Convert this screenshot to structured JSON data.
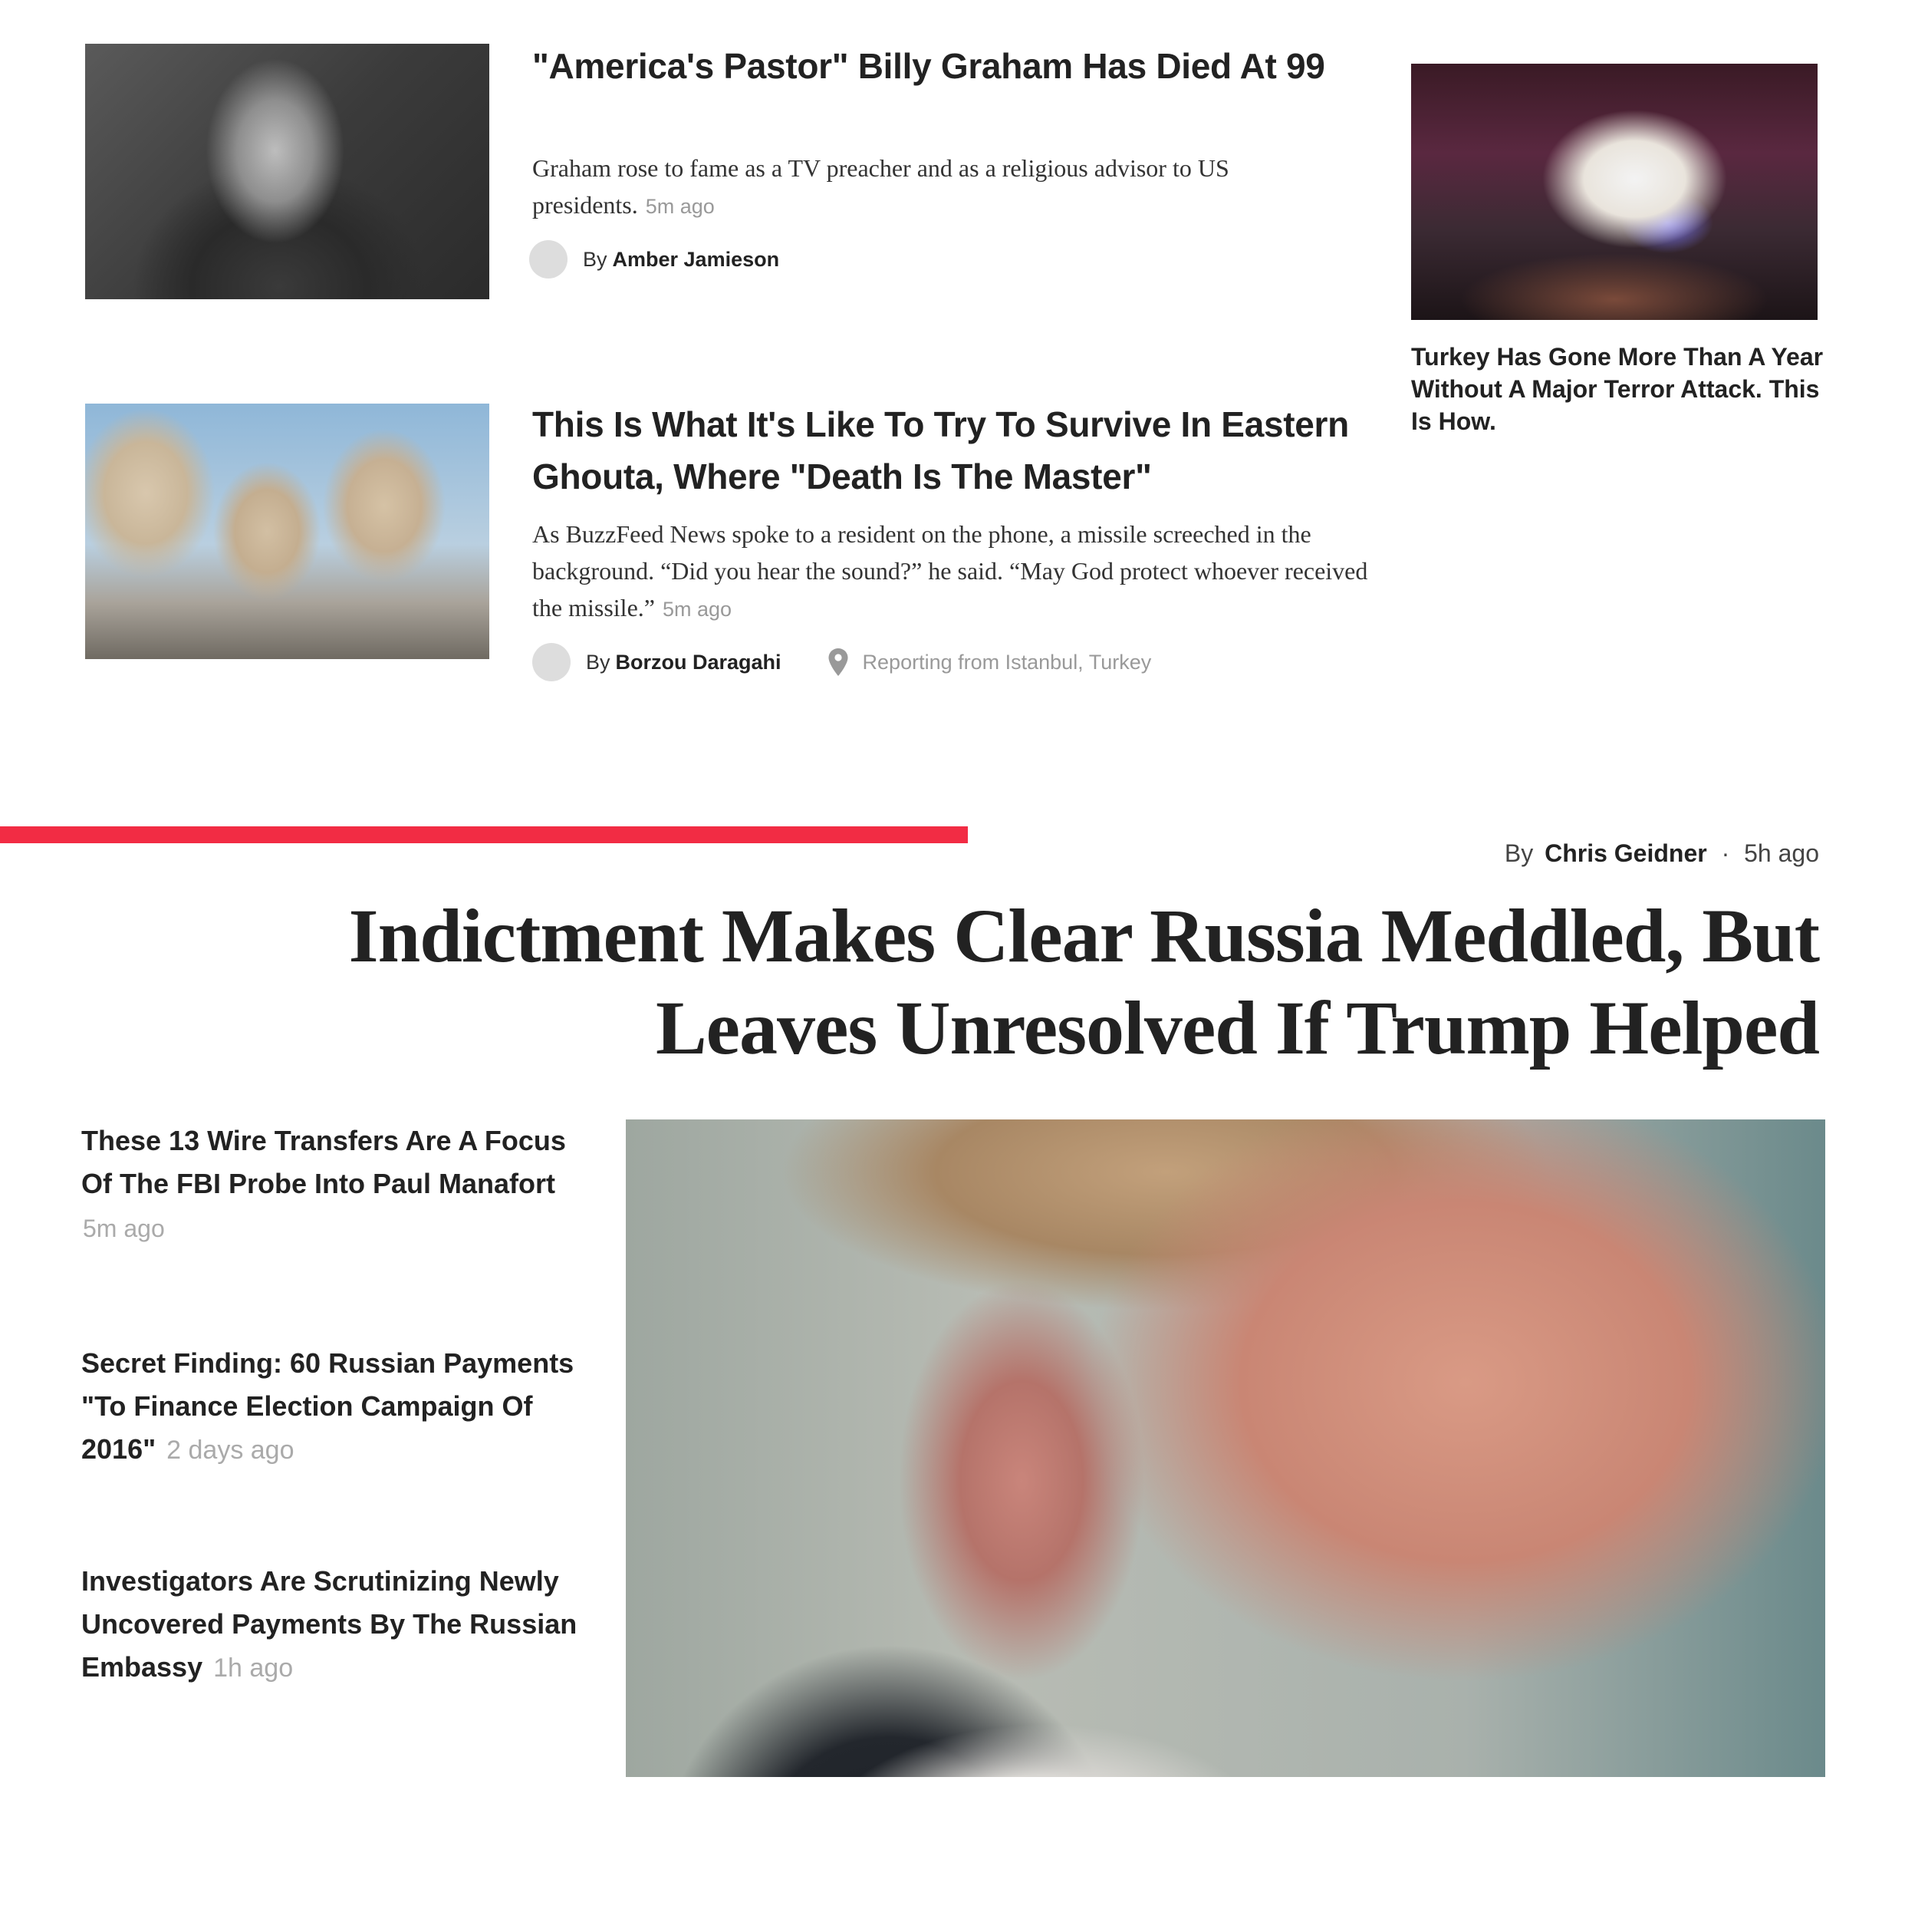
{
  "stories": [
    {
      "headline": "\"America's Pastor\" Billy Graham Has Died At 99",
      "description": "Graham rose to fame as a TV preacher and as a religious advisor to US presidents.",
      "time": "5m ago",
      "by": "By",
      "author": "Amber Jamieson"
    },
    {
      "headline": "This Is What It's Like To Try To Survive In Eastern Ghouta, Where \"Death Is The Master\"",
      "description": "As BuzzFeed News spoke to a resident on the phone, a missile screeched in the background. “Did you hear the sound?” he said. “May God protect whoever received the missile.”",
      "time": "5m ago",
      "by": "By",
      "author": "Borzou Daragahi",
      "location": "Reporting from Istanbul, Turkey"
    }
  ],
  "sidebar_story": {
    "headline": "Turkey Has Gone More Than A Year Without A Major Terror Attack. This Is How."
  },
  "feature": {
    "by": "By",
    "author": "Chris Geidner",
    "separator": "·",
    "time": "5h ago",
    "title": "Indictment Makes Clear Russia Meddled, But Leaves Unresolved If Trump Helped",
    "accent_color": "#f22c44",
    "related": [
      {
        "headline": "These 13 Wire Transfers Are A Focus Of The FBI Probe Into Paul Manafort",
        "time": "5m ago"
      },
      {
        "headline": "Secret Finding: 60 Russian Payments \"To Finance Election Campaign Of 2016\"",
        "time": "2 days ago"
      },
      {
        "headline": "Investigators Are Scrutinizing Newly Uncovered Payments By The Russian Embassy",
        "time": "1h ago"
      }
    ]
  },
  "icons": {
    "location": "location-pin-icon"
  }
}
